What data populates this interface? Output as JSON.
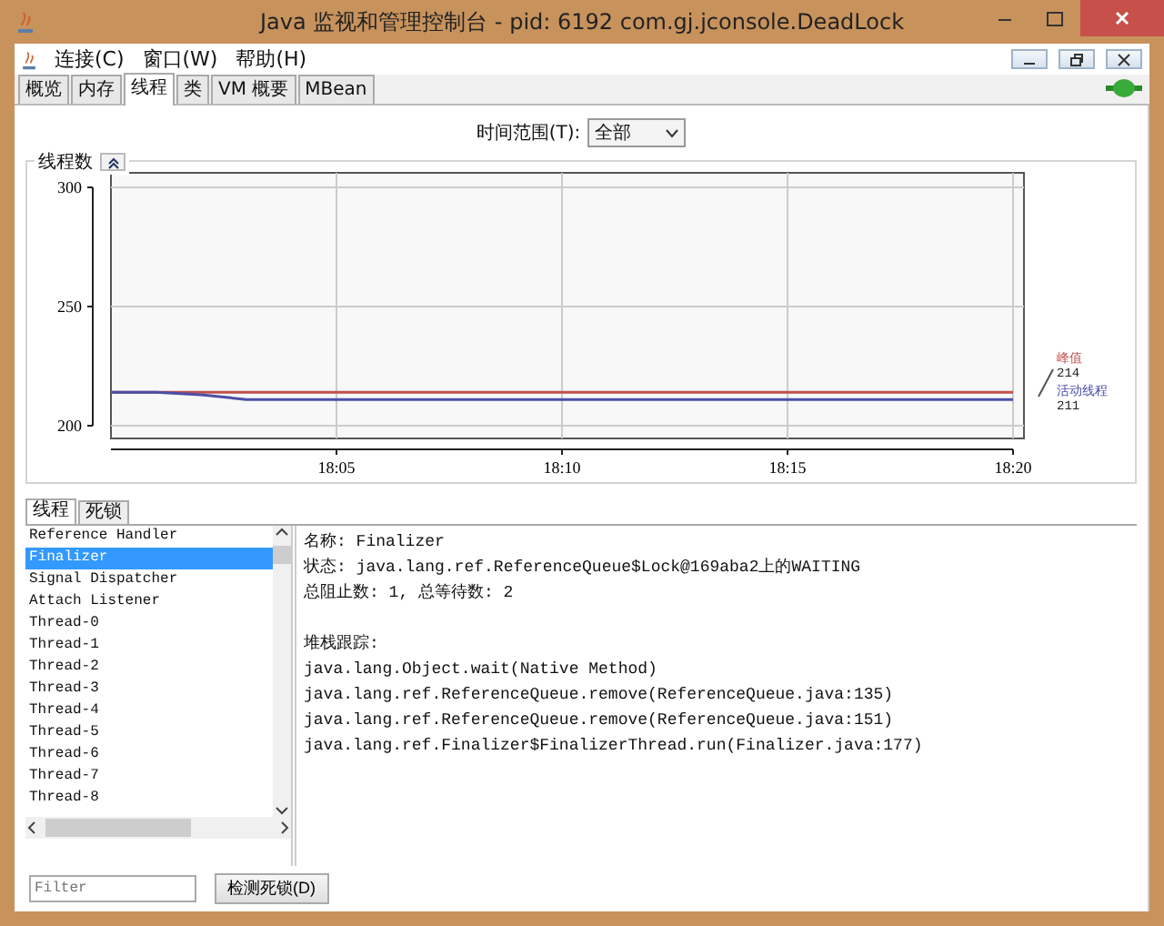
{
  "window": {
    "title": "Java 监视和管理控制台 - pid: 6192 com.gj.jconsole.DeadLock"
  },
  "menu": [
    "连接(C)",
    "窗口(W)",
    "帮助(H)"
  ],
  "tabs": [
    {
      "label": "概览",
      "selected": false
    },
    {
      "label": "内存",
      "selected": false
    },
    {
      "label": "线程",
      "selected": true
    },
    {
      "label": "类",
      "selected": false
    },
    {
      "label": "VM 概要",
      "selected": false
    },
    {
      "label": "MBean",
      "selected": false
    }
  ],
  "time_range": {
    "label": "时间范围(T):",
    "value": "全部"
  },
  "thread_chart": {
    "title": "线程数",
    "legend": [
      {
        "reading": "214"
      },
      {
        "reading": "211"
      }
    ],
    "chart_data": {
      "type": "line",
      "categories": [
        null,
        null,
        null,
        null,
        null,
        "18:05",
        null,
        null,
        null,
        null,
        "18:10",
        null,
        null,
        null,
        null,
        "18:15",
        null,
        null,
        null,
        null,
        "18:20"
      ],
      "ylim": [
        200,
        300
      ],
      "grid": true,
      "yticks": [
        200,
        250,
        300
      ],
      "series": [
        {
          "name": "峰值",
          "color": "#c0504d",
          "values": [
            214,
            214,
            214,
            214,
            214,
            214,
            214,
            214,
            214,
            214,
            214,
            214,
            214,
            214,
            214,
            214,
            214,
            214,
            214,
            214,
            214
          ]
        },
        {
          "name": "活动线程",
          "color": "#4b4fa6",
          "values": [
            214,
            214,
            213,
            211,
            211,
            211,
            211,
            211,
            211,
            211,
            211,
            211,
            211,
            211,
            211,
            211,
            211,
            211,
            211,
            211,
            211
          ]
        }
      ]
    }
  },
  "lower_tabs": [
    {
      "label": "线程",
      "selected": true
    },
    {
      "label": "死锁",
      "selected": false
    }
  ],
  "threads": [
    {
      "name": "Reference Handler",
      "selected": false
    },
    {
      "name": "Finalizer",
      "selected": true
    },
    {
      "name": "Signal Dispatcher",
      "selected": false
    },
    {
      "name": "Attach Listener",
      "selected": false
    },
    {
      "name": "Thread-0",
      "selected": false
    },
    {
      "name": "Thread-1",
      "selected": false
    },
    {
      "name": "Thread-2",
      "selected": false
    },
    {
      "name": "Thread-3",
      "selected": false
    },
    {
      "name": "Thread-4",
      "selected": false
    },
    {
      "name": "Thread-5",
      "selected": false
    },
    {
      "name": "Thread-6",
      "selected": false
    },
    {
      "name": "Thread-7",
      "selected": false
    },
    {
      "name": "Thread-8",
      "selected": false
    }
  ],
  "filter": {
    "placeholder": "Filter"
  },
  "detect_button": "检测死锁(D)",
  "details": {
    "lines": [
      "名称: Finalizer",
      "状态: java.lang.ref.ReferenceQueue$Lock@169aba2上的WAITING",
      "总阻止数: 1, 总等待数: 2"
    ],
    "stack_title": "堆栈跟踪:",
    "stack": [
      "java.lang.Object.wait(Native Method)",
      "java.lang.ref.ReferenceQueue.remove(ReferenceQueue.java:135)",
      "java.lang.ref.ReferenceQueue.remove(ReferenceQueue.java:151)",
      "java.lang.ref.Finalizer$FinalizerThread.run(Finalizer.java:177)"
    ]
  }
}
